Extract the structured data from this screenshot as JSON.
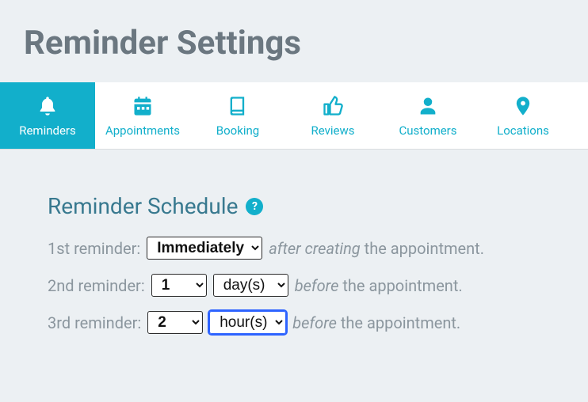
{
  "page": {
    "title": "Reminder Settings"
  },
  "tabs": [
    {
      "name": "reminders",
      "label": "Reminders",
      "icon": "bell-icon",
      "active": true
    },
    {
      "name": "appointments",
      "label": "Appointments",
      "icon": "calendar-icon",
      "active": false
    },
    {
      "name": "booking",
      "label": "Booking",
      "icon": "book-icon",
      "active": false
    },
    {
      "name": "reviews",
      "label": "Reviews",
      "icon": "thumbs-up-icon",
      "active": false
    },
    {
      "name": "customers",
      "label": "Customers",
      "icon": "user-icon",
      "active": false
    },
    {
      "name": "locations",
      "label": "Locations",
      "icon": "pin-icon",
      "active": false
    }
  ],
  "section": {
    "title": "Reminder Schedule",
    "help_symbol": "?"
  },
  "reminders": [
    {
      "label": "1st reminder:",
      "value_select": {
        "selected": "Immediately",
        "options": [
          "Immediately"
        ]
      },
      "unit_select": null,
      "suffix_italic": "after creating",
      "suffix_plain": "the appointment."
    },
    {
      "label": "2nd reminder:",
      "value_select": {
        "selected": "1",
        "options": [
          "1"
        ]
      },
      "unit_select": {
        "selected": "day(s)",
        "options": [
          "day(s)"
        ],
        "focused": false
      },
      "suffix_italic": "before",
      "suffix_plain": "the appointment."
    },
    {
      "label": "3rd reminder:",
      "value_select": {
        "selected": "2",
        "options": [
          "2"
        ]
      },
      "unit_select": {
        "selected": "hour(s)",
        "options": [
          "hour(s)"
        ],
        "focused": true
      },
      "suffix_italic": "before",
      "suffix_plain": "the appointment."
    }
  ],
  "colors": {
    "accent": "#12afcb",
    "heading": "#38798f",
    "text": "#8b969e"
  }
}
